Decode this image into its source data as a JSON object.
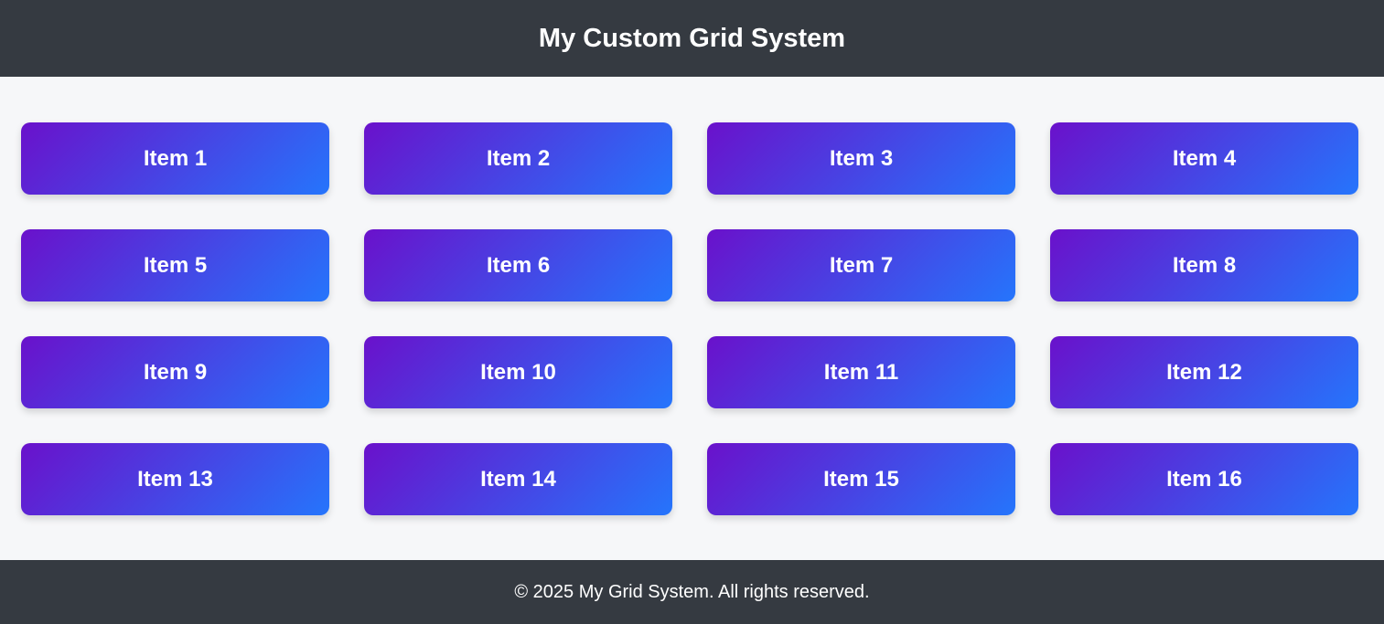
{
  "header": {
    "title": "My Custom Grid System"
  },
  "grid": {
    "items": [
      "Item 1",
      "Item 2",
      "Item 3",
      "Item 4",
      "Item 5",
      "Item 6",
      "Item 7",
      "Item 8",
      "Item 9",
      "Item 10",
      "Item 11",
      "Item 12",
      "Item 13",
      "Item 14",
      "Item 15",
      "Item 16"
    ]
  },
  "footer": {
    "text": "© 2025 My Grid System. All rights reserved."
  },
  "colors": {
    "header_bg": "#353a41",
    "page_bg": "#f6f7f9",
    "gradient_start": "#6a11cb",
    "gradient_end": "#2575fc",
    "text": "#ffffff"
  }
}
